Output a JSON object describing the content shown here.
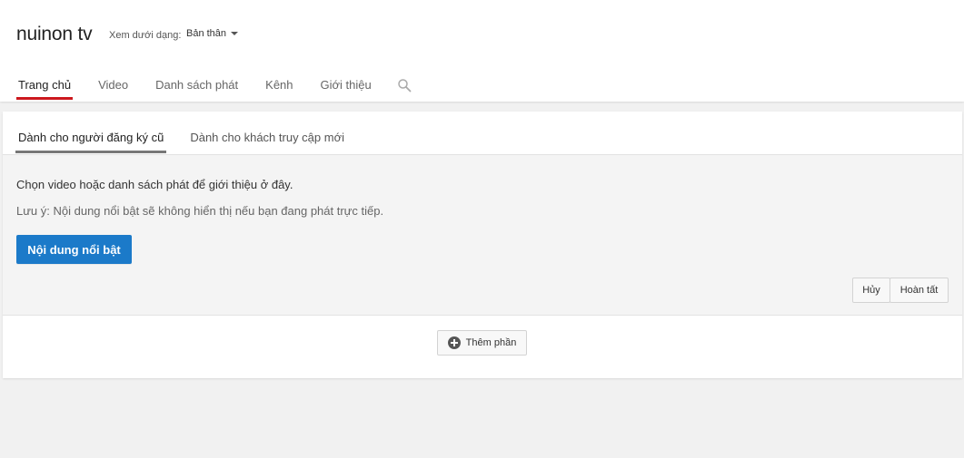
{
  "header": {
    "channel_title": "nuinon tv",
    "view_as_label": "Xem dưới dạng:",
    "view_as_value": "Bản thân"
  },
  "nav": {
    "tabs": [
      {
        "label": "Trang chủ",
        "active": true
      },
      {
        "label": "Video",
        "active": false
      },
      {
        "label": "Danh sách phát",
        "active": false
      },
      {
        "label": "Kênh",
        "active": false
      },
      {
        "label": "Giới thiệu",
        "active": false
      }
    ],
    "search_icon": "search-icon"
  },
  "subtabs": [
    {
      "label": "Dành cho người đăng ký cũ",
      "active": true
    },
    {
      "label": "Dành cho khách truy cập mới",
      "active": false
    }
  ],
  "editor": {
    "text1": "Chọn video hoặc danh sách phát để giới thiệu ở đây.",
    "text2": "Lưu ý: Nội dung nổi bật sẽ không hiển thị nếu bạn đang phát trực tiếp.",
    "featured_button": "Nội dung nổi bật",
    "cancel_button": "Hủy",
    "done_button": "Hoàn tất"
  },
  "add_section_button": "Thêm phần",
  "colors": {
    "accent_blue": "#1b7ac9",
    "active_tab_red": "#cc181e"
  }
}
